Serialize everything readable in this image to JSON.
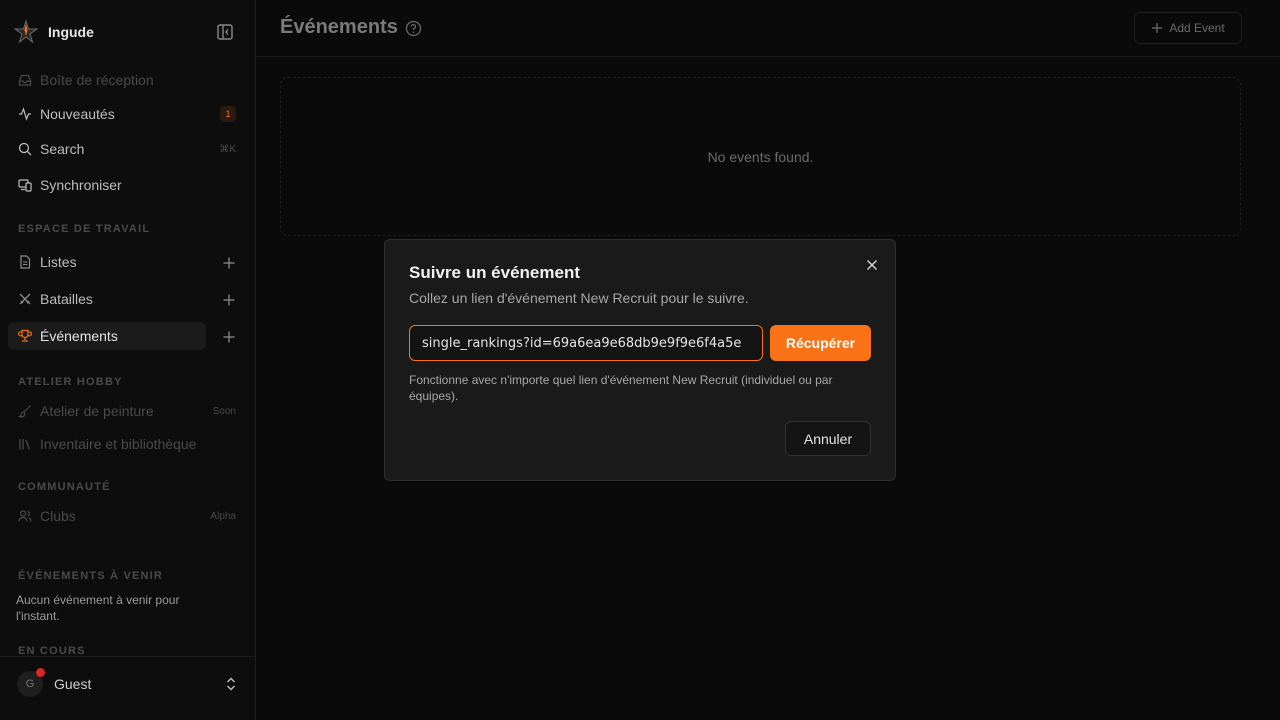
{
  "brand": {
    "name": "Ingude"
  },
  "sidebar": {
    "top_items": [
      {
        "label": "Boîte de réception",
        "icon": "inbox-icon"
      },
      {
        "label": "Nouveautés",
        "icon": "activity-icon",
        "badge": "1"
      },
      {
        "label": "Search",
        "icon": "search-icon",
        "shortcut": "⌘K"
      },
      {
        "label": "Synchroniser",
        "icon": "devices-icon"
      }
    ],
    "workspace": {
      "title": "ESPACE DE TRAVAIL",
      "items": [
        {
          "label": "Listes",
          "icon": "file-icon"
        },
        {
          "label": "Batailles",
          "icon": "swords-icon"
        },
        {
          "label": "Événements",
          "icon": "trophy-icon"
        }
      ]
    },
    "hobby": {
      "title": "ATELIER HOBBY",
      "items": [
        {
          "label": "Atelier de peinture",
          "icon": "brush-icon",
          "tag": "Soon"
        },
        {
          "label": "Inventaire et bibliothèque",
          "icon": "library-icon"
        }
      ]
    },
    "community": {
      "title": "COMMUNAUTÉ",
      "items": [
        {
          "label": "Clubs",
          "icon": "users-icon",
          "tag": "Alpha"
        }
      ]
    },
    "upcoming": {
      "title": "ÉVÉNEMENTS À VENIR",
      "empty_text": "Aucun événement à venir pour l'instant."
    },
    "ongoing": {
      "title": "EN COURS"
    },
    "user": {
      "initial": "G",
      "name": "Guest"
    }
  },
  "main": {
    "title": "Événements",
    "add_event_label": "Add Event",
    "empty_text": "No events found."
  },
  "dialog": {
    "title": "Suivre un événement",
    "subtitle": "Collez un lien d'événement New Recruit pour le suivre.",
    "input_value": "single_rankings?id=69a6ea9e68db9e9f9e6f4a5e",
    "fetch_label": "Récupérer",
    "hint": "Fonctionne avec n'importe quel lien d'événement New Recruit (individuel ou par équipes).",
    "cancel_label": "Annuler"
  },
  "colors": {
    "accent": "#f97316",
    "background": "#0a0a0a",
    "dialog": "#1a1a1a"
  }
}
